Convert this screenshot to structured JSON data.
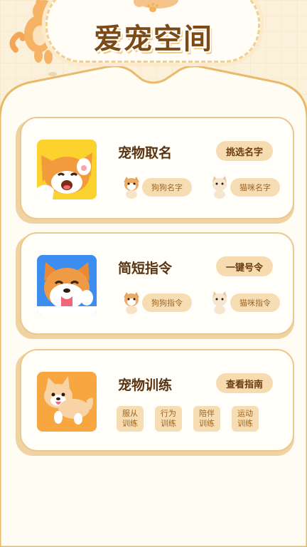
{
  "header": {
    "title": "爱宠空间"
  },
  "cards": [
    {
      "title": "宠物取名",
      "button": "挑选名字",
      "chips": [
        "狗狗名字",
        "猫咪名字"
      ]
    },
    {
      "title": "简短指令",
      "button": "一键号令",
      "chips": [
        "狗狗指令",
        "猫咪指令"
      ]
    },
    {
      "title": "宠物训练",
      "button": "查看指南",
      "tags": [
        "服从\n训练",
        "行为\n训练",
        "陪伴\n训练",
        "运动\n训练"
      ]
    }
  ],
  "colors": {
    "background": "#fbf3e0",
    "card": "#fffef9",
    "card_border": "#ecc88e",
    "button": "#f6dcb0",
    "title_text": "#7c4a14",
    "icon1_bg": "#fbd22e",
    "icon2_bg": "#3b8df0",
    "icon3_bg": "#f7a640"
  }
}
